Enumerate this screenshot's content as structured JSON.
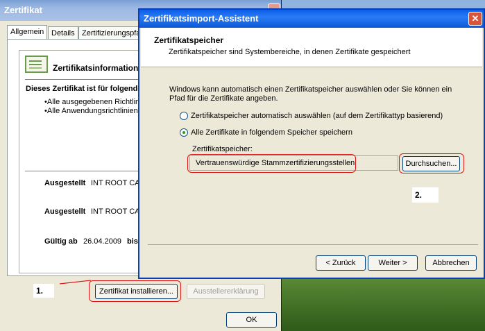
{
  "back_dialog": {
    "title": "Zertifikat",
    "tabs": [
      "Allgemein",
      "Details",
      "Zertifizierungspfad"
    ],
    "cert_info_heading": "Zertifikatsinformationen",
    "purpose_heading": "Dieses Zertifikat ist für folgende Zwecke beabsichtigt:",
    "purposes": [
      "•Alle ausgegebenen Richtlinien",
      "•Alle Anwendungsrichtlinien"
    ],
    "issued_to_label": "Ausgestellt",
    "issued_to_value": "INT ROOT CA",
    "issued_by_label": "Ausgestellt",
    "issued_by_value": "INT ROOT CA",
    "valid_label": "Gültig ab",
    "valid_from": "26.04.2009",
    "valid_to_label": "bis",
    "install_button": "Zertifikat installieren...",
    "issuer_statement_button": "Ausstellererklärung",
    "ok_button": "OK"
  },
  "wizard": {
    "title": "Zertifikatsimport-Assistent",
    "header_title": "Zertifikatspeicher",
    "header_subtitle": "Zertifikatspeicher sind Systembereiche, in denen Zertifikate gespeichert",
    "description": "Windows kann automatisch einen Zertifikatspeicher auswählen oder Sie können ein Pfad für die Zertifikate angeben.",
    "option_auto": "Zertifikatspeicher automatisch auswählen (auf dem Zertifikattyp basierend)",
    "option_manual": "Alle Zertifikate in folgendem Speicher speichern",
    "selected_option": "manual",
    "store_label": "Zertifikatspeicher:",
    "store_value": "Vertrauenswürdige Stammzertifizierungsstellen",
    "browse_button": "Durchsuchen...",
    "back_button": "< Zurück",
    "next_button": "Weiter >",
    "cancel_button": "Abbrechen"
  },
  "annotations": {
    "step1": "1.",
    "step2": "2."
  },
  "colors": {
    "annotation_red": "#dd1111",
    "wizard_titlebar": "#0a5ee8"
  }
}
